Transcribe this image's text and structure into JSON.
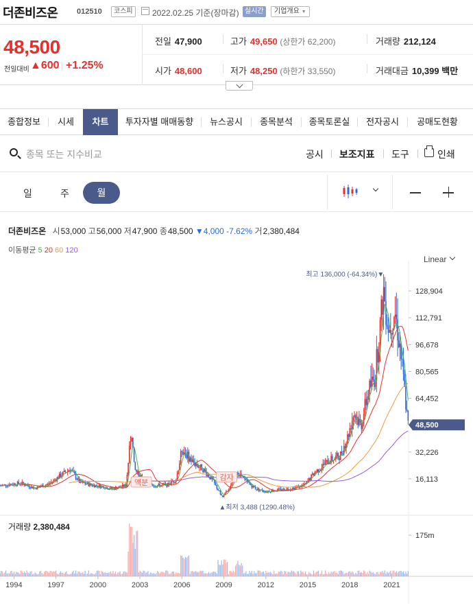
{
  "header": {
    "name": "더존비즈온",
    "code": "012510",
    "market": "코스피",
    "date": "2022.02.25 기준(장마감)",
    "live_badge": "실시간",
    "info_button": "기업개요"
  },
  "quote": {
    "price": "48,500",
    "change_label": "전일대비",
    "change_abs": "▲600",
    "change_pct": "+1.25%",
    "prev_label": "전일",
    "prev": "47,900",
    "high_label": "고가",
    "high": "49,650",
    "upper_label": "상한가",
    "upper": "62,200",
    "volume_label": "거래량",
    "volume": "212,124",
    "open_label": "시가",
    "open": "48,600",
    "low_label": "저가",
    "low": "48,250",
    "lower_label": "하한가",
    "lower": "33,550",
    "amount_label": "거래대금",
    "amount": "10,399",
    "amount_unit": "백만"
  },
  "tabs": [
    "종합정보",
    "시세",
    "차트",
    "투자자별 매매동향",
    "뉴스공시",
    "종목분석",
    "종목토론실",
    "전자공시",
    "공매도현황"
  ],
  "active_tab": "차트",
  "toolbar": {
    "search_placeholder": "종목 또는 지수비교",
    "notice": "공시",
    "indicator": "보조지표",
    "tools": "도구",
    "print": "인쇄"
  },
  "periods": {
    "day": "일",
    "week": "주",
    "month": "월"
  },
  "legend": {
    "name": "더존비즈온",
    "open_label": "시",
    "open": "53,000",
    "high_label": "고",
    "high": "56,000",
    "low_label": "저",
    "low": "47,900",
    "close_label": "종",
    "close": "48,500",
    "change": "▼4,000 -7.62%",
    "vol_label": "거",
    "vol": "2,380,484",
    "ma_label": "이동평균",
    "ma_5": "5",
    "ma_20": "20",
    "ma_60": "60",
    "ma_120": "120",
    "scale": "Linear"
  },
  "volume_title_label": "거래량",
  "volume_title_value": "2,380,484",
  "colors": {
    "up": "#e5302c",
    "down": "#2b6ad9",
    "accent": "#4a5a8a",
    "ma5": "#49b04b",
    "ma20": "#e5302c",
    "ma60": "#f09a3c",
    "ma120": "#9b59d6"
  },
  "chart_data": {
    "type": "candlestick",
    "title": "",
    "ytick_labels": [
      "128,904",
      "112,791",
      "96,678",
      "80,565",
      "64,452",
      "32,226",
      "16,113"
    ],
    "yticks": [
      128904,
      112791,
      96678,
      80565,
      64452,
      32226,
      16113
    ],
    "ylim": [
      0,
      145000
    ],
    "xtick_labels": [
      "1994",
      "1997",
      "2000",
      "2003",
      "2006",
      "2009",
      "2012",
      "2015",
      "2018",
      "2021"
    ],
    "x_range": [
      1993.0,
      2022.2
    ],
    "last_price_label": "48,500",
    "last_price": 48500,
    "max_annotation": "최고 136,000 (-64.34%)▼",
    "max": {
      "year": 2020.4,
      "value": 136000
    },
    "min_annotation": "▲최저 3,488 (1290.48%)",
    "min": {
      "year": 2008.9,
      "value": 3488
    },
    "markers": [
      {
        "label": "액분",
        "year": 2003.1,
        "value": 14000
      },
      {
        "label": "감자",
        "year": 2009.2,
        "value": 17000
      }
    ],
    "volume_ytick_label": "175m",
    "volume_ytick": 175000000,
    "monthly_close_anchors": [
      [
        1993.0,
        12000
      ],
      [
        1994.5,
        13500
      ],
      [
        1995.5,
        10500
      ],
      [
        1996.5,
        13000
      ],
      [
        1997.3,
        18000
      ],
      [
        1998.0,
        22000
      ],
      [
        1998.7,
        14000
      ],
      [
        1999.5,
        12500
      ],
      [
        2000.3,
        11500
      ],
      [
        2001.0,
        10000
      ],
      [
        2002.0,
        12000
      ],
      [
        2002.4,
        46000
      ],
      [
        2002.6,
        22000
      ],
      [
        2003.2,
        15000
      ],
      [
        2004.0,
        12000
      ],
      [
        2005.0,
        12500
      ],
      [
        2005.6,
        16000
      ],
      [
        2006.0,
        34000
      ],
      [
        2006.8,
        26000
      ],
      [
        2007.5,
        22000
      ],
      [
        2008.2,
        15000
      ],
      [
        2008.9,
        5000
      ],
      [
        2009.5,
        12000
      ],
      [
        2010.0,
        20000
      ],
      [
        2010.5,
        15000
      ],
      [
        2011.3,
        10000
      ],
      [
        2012.0,
        8500
      ],
      [
        2013.0,
        9500
      ],
      [
        2014.0,
        10500
      ],
      [
        2014.8,
        12500
      ],
      [
        2015.5,
        20000
      ],
      [
        2016.5,
        27000
      ],
      [
        2017.3,
        30000
      ],
      [
        2017.8,
        40000
      ],
      [
        2018.3,
        56000
      ],
      [
        2018.8,
        48000
      ],
      [
        2019.3,
        68000
      ],
      [
        2019.8,
        78000
      ],
      [
        2020.2,
        110000
      ],
      [
        2020.4,
        130000
      ],
      [
        2020.8,
        105000
      ],
      [
        2021.2,
        118000
      ],
      [
        2021.6,
        95000
      ],
      [
        2021.9,
        70000
      ],
      [
        2022.15,
        48500
      ]
    ]
  }
}
